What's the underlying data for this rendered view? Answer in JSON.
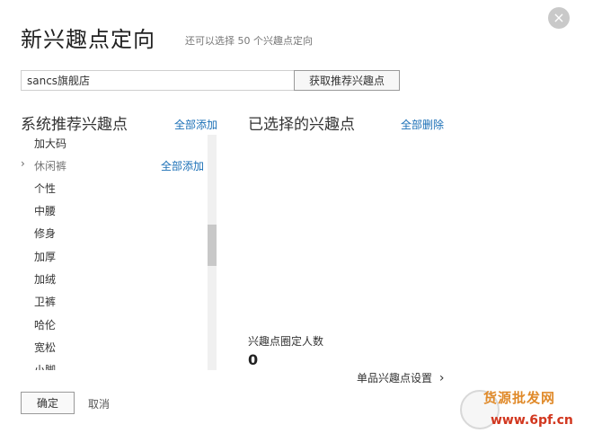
{
  "dialog": {
    "title": "新兴趣点定向",
    "subtitle": "还可以选择 50 个兴趣点定向",
    "close_icon": "×"
  },
  "search": {
    "value": "sancs旗舰店",
    "button_label": "获取推荐兴趣点"
  },
  "recommended": {
    "title": "系统推荐兴趣点",
    "add_all_label": "全部添加",
    "cut_off_top": "加大码",
    "group": {
      "label": "休闲裤",
      "add_all_label": "全部添加"
    },
    "items": [
      "个性",
      "中腰",
      "修身",
      "加厚",
      "加绒",
      "卫裤",
      "哈伦",
      "宽松",
      "小脚"
    ]
  },
  "selected": {
    "title": "已选择的兴趣点",
    "delete_all_label": "全部删除"
  },
  "stats": {
    "label": "兴趣点圈定人数",
    "value": "0"
  },
  "single_setting": {
    "label": "单品兴趣点设置",
    "chevron": "›"
  },
  "footer": {
    "ok_label": "确定",
    "cancel_label": "取消"
  },
  "watermark": {
    "top": "货源批发网",
    "bottom": "www.6pf.cn"
  },
  "colors": {
    "link": "#1a6fb6",
    "close_bg": "#c9c9c9",
    "watermark_orange": "#e08a2a",
    "watermark_red": "#d2371f"
  }
}
